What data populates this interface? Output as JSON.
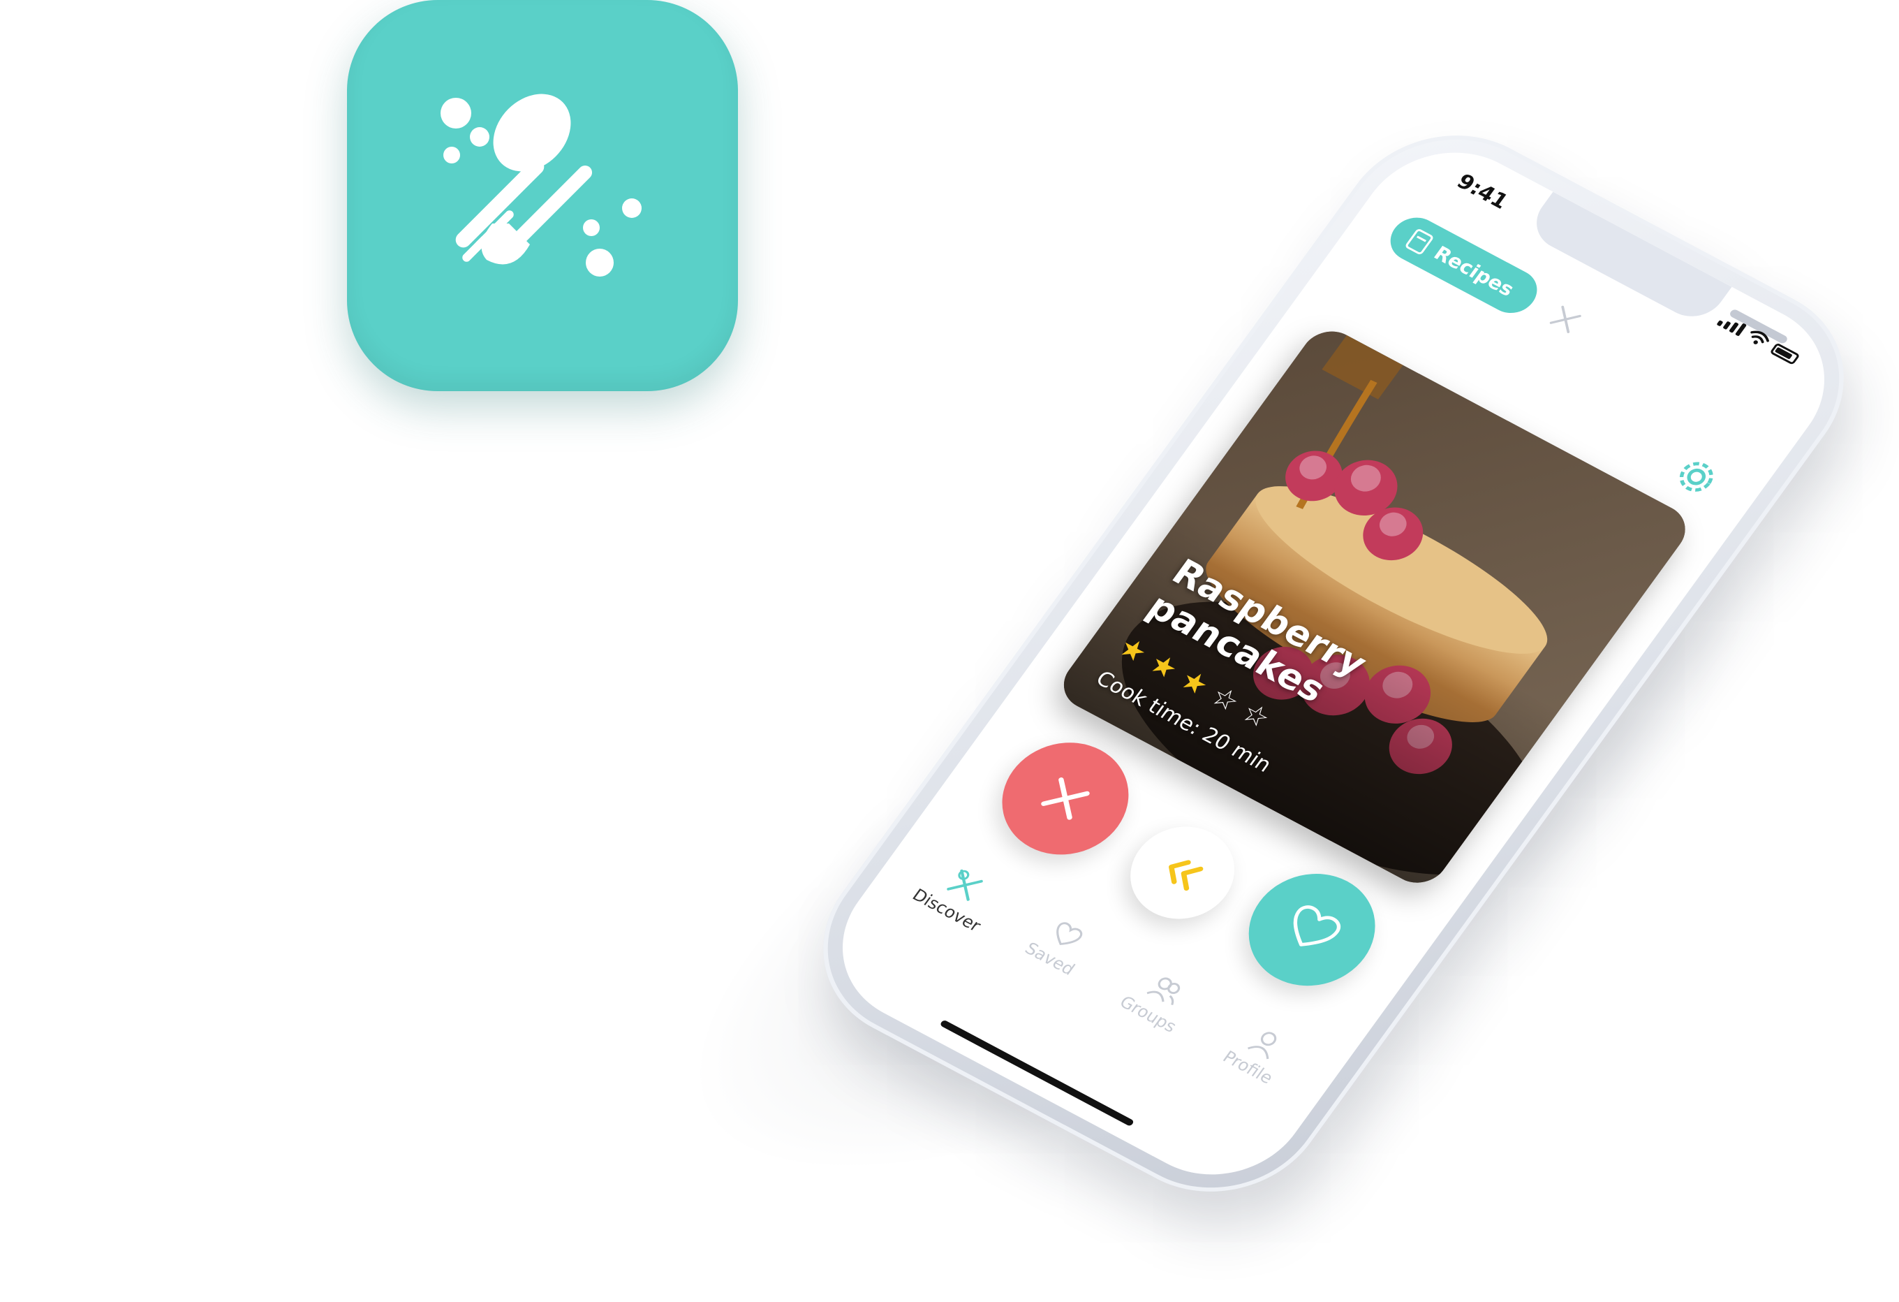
{
  "app_icon": {
    "name": "app-icon",
    "color": "#5ad0c8"
  },
  "status_bar": {
    "time": "9:41"
  },
  "top_tabs": {
    "recipes_label": "Recipes",
    "recipes_icon": "book-icon",
    "discover_icon": "utensils-icon"
  },
  "settings": {
    "icon": "gear-icon"
  },
  "recipe_card": {
    "title": "Raspberry pancakes",
    "rating": 3,
    "rating_max": 5,
    "cook_time": "Cook time: 20 min"
  },
  "actions": {
    "dismiss_icon": "close-icon",
    "undo_icon": "rewind-icon",
    "like_icon": "heart-icon"
  },
  "bottom_nav": {
    "items": [
      {
        "label": "Discover",
        "icon": "utensils-icon",
        "active": true
      },
      {
        "label": "Saved",
        "icon": "heart-icon",
        "active": false
      },
      {
        "label": "Groups",
        "icon": "users-icon",
        "active": false
      },
      {
        "label": "Profile",
        "icon": "user-icon",
        "active": false
      }
    ]
  },
  "colors": {
    "accent": "#5ad0c8",
    "dismiss": "#ef6b70",
    "undo": "#f6c51b",
    "star": "#f6c51b"
  }
}
